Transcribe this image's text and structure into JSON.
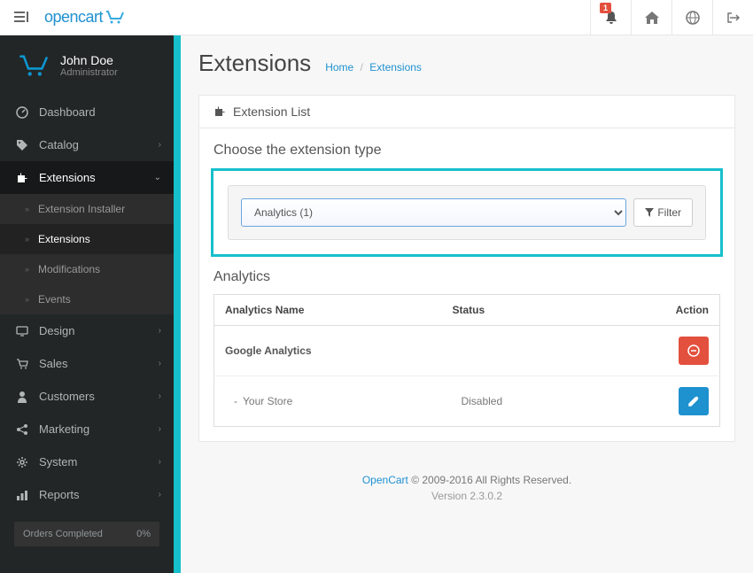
{
  "header": {
    "logo_text": "opencart",
    "notification_count": "1"
  },
  "user": {
    "name": "John Doe",
    "role": "Administrator"
  },
  "nav": {
    "items": [
      {
        "label": "Dashboard"
      },
      {
        "label": "Catalog"
      },
      {
        "label": "Extensions"
      },
      {
        "label": "Design"
      },
      {
        "label": "Sales"
      },
      {
        "label": "Customers"
      },
      {
        "label": "Marketing"
      },
      {
        "label": "System"
      },
      {
        "label": "Reports"
      }
    ],
    "extensions_sub": [
      {
        "label": "Extension Installer"
      },
      {
        "label": "Extensions"
      },
      {
        "label": "Modifications"
      },
      {
        "label": "Events"
      }
    ]
  },
  "progress": {
    "label": "Orders Completed",
    "value": "0%"
  },
  "page": {
    "title": "Extensions",
    "breadcrumb_home": "Home",
    "breadcrumb_current": "Extensions"
  },
  "panel": {
    "title": "Extension List",
    "section_heading": "Choose the extension type",
    "type_selected": "Analytics (1)",
    "filter_label": "Filter",
    "table_heading": "Analytics"
  },
  "table": {
    "col_name": "Analytics Name",
    "col_status": "Status",
    "col_action": "Action",
    "rows": [
      {
        "name": "Google Analytics",
        "status": "",
        "action": "uninstall"
      },
      {
        "name": "Your Store",
        "status": "Disabled",
        "action": "edit",
        "sub": true
      }
    ]
  },
  "footer": {
    "link_text": "OpenCart",
    "copyright": " © 2009-2016 All Rights Reserved.",
    "version": "Version 2.3.0.2"
  }
}
